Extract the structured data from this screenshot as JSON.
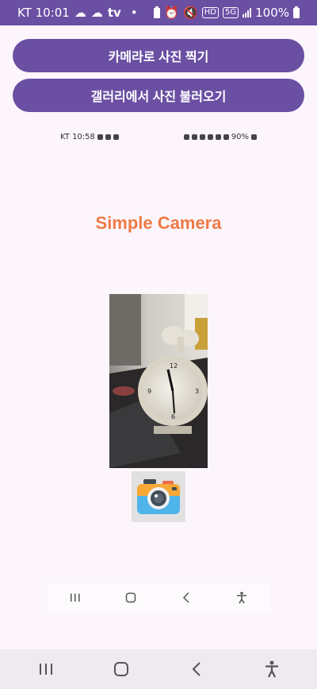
{
  "status_bar": {
    "carrier_time": "KT 10:01",
    "tv": "tv",
    "dot": "•",
    "hd": "HD",
    "network": "5G",
    "battery": "100%"
  },
  "buttons": {
    "camera_label": "카메라로 사진 찍기",
    "gallery_label": "갤러리에서 사진 불러오기"
  },
  "inner_status": {
    "carrier_time": "KT 10:58",
    "battery": "90%"
  },
  "app": {
    "title": "Simple Camera"
  },
  "colors": {
    "primary": "#6a4fa3",
    "title": "#ee7a45",
    "background": "#fcf5fc"
  },
  "icons": {
    "camera_button": "camera-icon",
    "nav_recent": "recent-apps-icon",
    "nav_home": "home-icon",
    "nav_back": "back-icon",
    "nav_accessibility": "accessibility-icon"
  }
}
